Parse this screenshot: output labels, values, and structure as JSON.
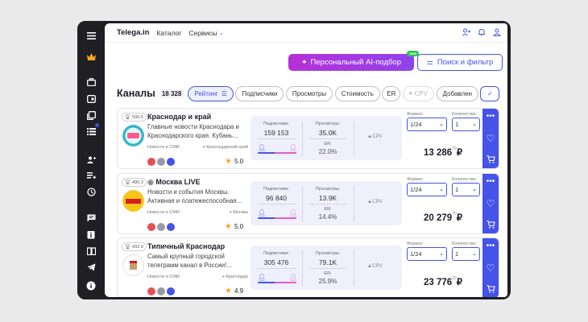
{
  "app": {
    "logo": "Telega.in",
    "nav": [
      "Каталог",
      "Сервисы"
    ]
  },
  "colors": {
    "accent": "#4453e8",
    "ai_gradient": [
      "#b630d8",
      "#8f43ea"
    ],
    "new_badge": "#2bc24a",
    "star": "#f5a623",
    "sidebar_bg": "#1f1f24"
  },
  "actions": {
    "ai_button": "Персональный AI-подбор",
    "ai_badge": "new",
    "filter_button": "Поиск и фильтр"
  },
  "list": {
    "title": "Каналы",
    "count": "18 328",
    "sort_pills": [
      "Рейтинг",
      "Подписчики",
      "Просмотры",
      "Стоимость",
      "ER",
      "CPV",
      "Добавлен"
    ]
  },
  "labels": {
    "subscribers": "Подписчики:",
    "views": "Просмотры:",
    "er": "ER:",
    "cpv": "CPV",
    "format": "Формат:",
    "quantity": "Количество:"
  },
  "channels": [
    {
      "rank": "590.5",
      "name": "Краснодар и край",
      "desc": "Главные новости Краснодара и Краснодарского края. Кубань...",
      "category": "Новости и СМИ",
      "geo": "Краснодарский край",
      "rating": "5.0",
      "subscribers": "159 153",
      "views": "35.0K",
      "er": "22.0%",
      "format": "1/24",
      "quantity": "1",
      "price": "13 286",
      "price_cents": "70",
      "currency": "₽"
    },
    {
      "rank": "490.3",
      "name": "Москва LIVE",
      "desc": "Новости и события Москвы. Активная и платежеспособная...",
      "category": "Новости и СМИ",
      "geo": "Москва",
      "rating": "5.0",
      "subscribers": "96 840",
      "views": "13.9K",
      "er": "14.4%",
      "format": "1/24",
      "quantity": "1",
      "price": "20 279",
      "price_cents": "70",
      "currency": "₽"
    },
    {
      "rank": "432.9",
      "name": "Типичный Краснодар",
      "desc": "Самый крупный городской телеграмм канал в России!...",
      "category": "Новости и СМИ",
      "geo": "Краснодар",
      "rating": "4.9",
      "subscribers": "305 476",
      "views": "79.1K",
      "er": "25.9%",
      "format": "1/24",
      "quantity": "1",
      "price": "23 776",
      "price_cents": "20",
      "currency": "₽"
    }
  ]
}
